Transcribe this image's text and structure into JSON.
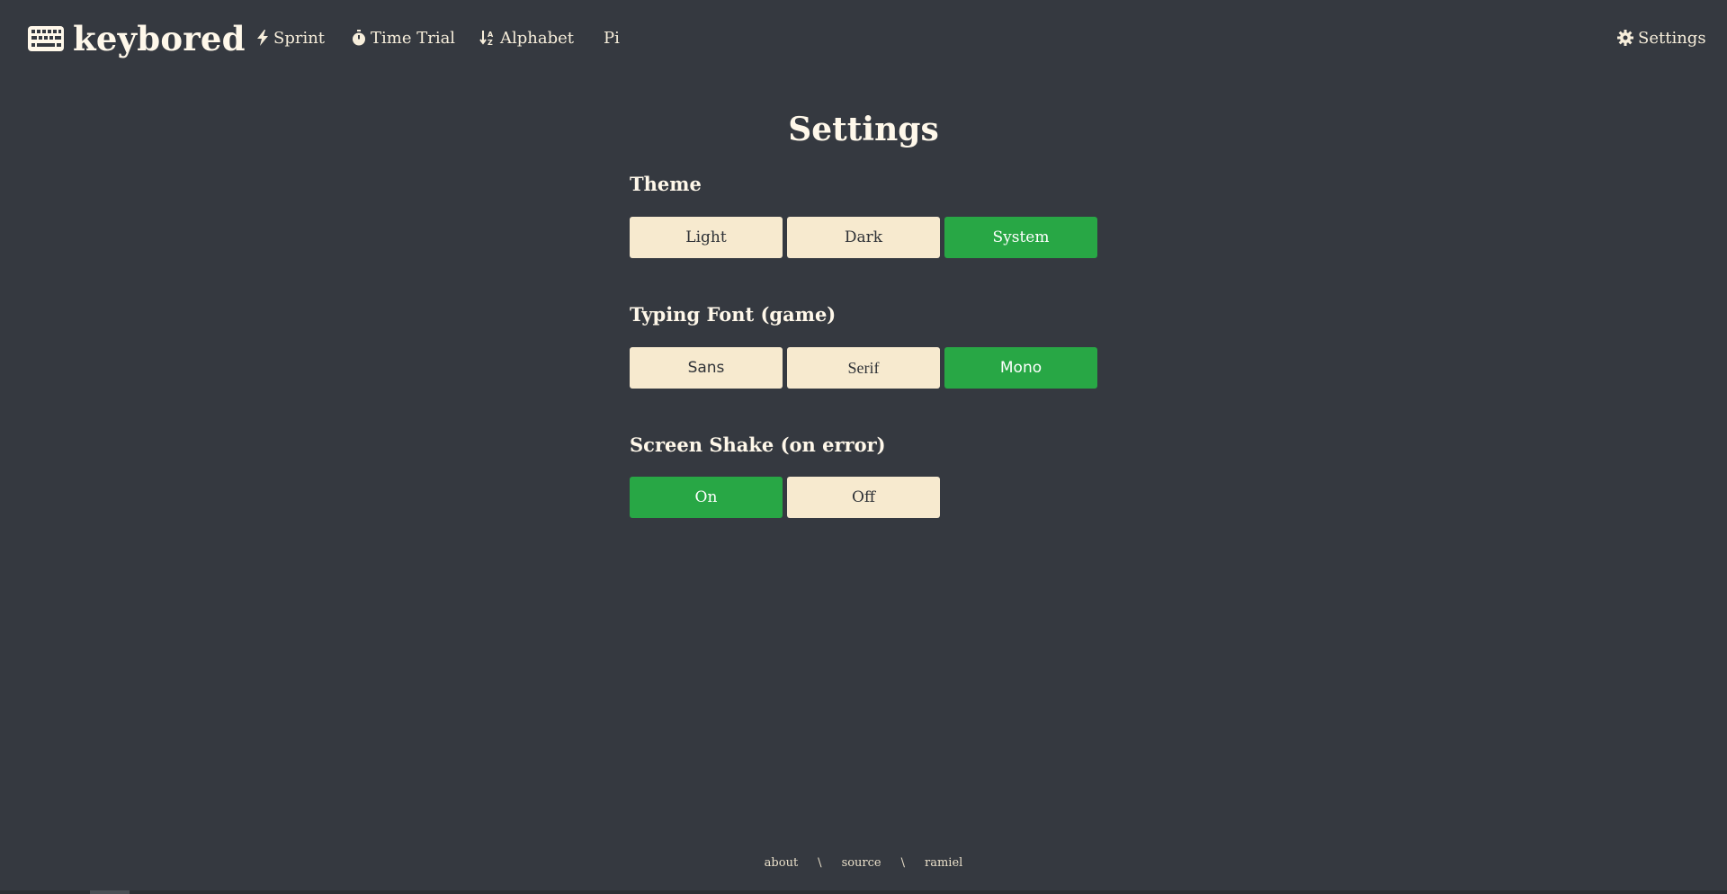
{
  "brand": {
    "name": "keybored",
    "icon": "keyboard-icon"
  },
  "nav": {
    "items": [
      {
        "label": "Sprint",
        "icon": "bolt-icon"
      },
      {
        "label": "Time Trial",
        "icon": "stopwatch-icon"
      },
      {
        "label": "Alphabet",
        "icon": "sort-alpha-icon"
      },
      {
        "label": "Pi",
        "icon": ""
      }
    ],
    "settings": {
      "label": "Settings",
      "icon": "gear-icon"
    }
  },
  "page": {
    "title": "Settings"
  },
  "settings": {
    "theme": {
      "label": "Theme",
      "options": [
        "Light",
        "Dark",
        "System"
      ],
      "selected": "System"
    },
    "typing_font": {
      "label": "Typing Font (game)",
      "options": [
        "Sans",
        "Serif",
        "Mono"
      ],
      "selected": "Mono"
    },
    "screen_shake": {
      "label": "Screen Shake (on error)",
      "options": [
        "On",
        "Off"
      ],
      "selected": "On"
    }
  },
  "footer": {
    "links": [
      "about",
      "source",
      "ramiel"
    ],
    "separator": "\\"
  },
  "colors": {
    "background": "#353940",
    "accent": "#28a745",
    "button": "#f7eacf",
    "text": "#f7eedb"
  }
}
